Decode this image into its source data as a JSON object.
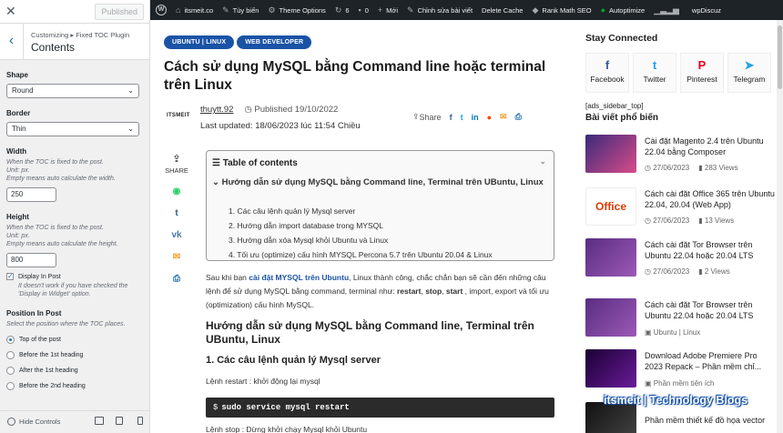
{
  "customizer": {
    "close_icon": "✕",
    "publish_label": "Published",
    "breadcrumb": "Customizing ▸ Fixed TOC Plugin",
    "section_title": "Contents",
    "shape": {
      "label": "Shape",
      "value": "Round"
    },
    "border": {
      "label": "Border",
      "value": "Thin"
    },
    "width": {
      "label": "Width",
      "desc1": "When the TOC is fixed to the post.",
      "desc2": "Unit: px.",
      "desc3": "Empty means auto calculate the width.",
      "value": "250"
    },
    "height": {
      "label": "Height",
      "desc1": "When the TOC is fixed to the post.",
      "desc2": "Unit: px.",
      "desc3": "Empty means auto calculate the height.",
      "value": "800"
    },
    "display_in_post": {
      "label": "Display In Post",
      "note1": "It doesn't work if you have checked the",
      "note2": "'Display in Widget' option.",
      "checked": true
    },
    "position": {
      "label": "Position In Post",
      "desc": "Select the position where the TOC places.",
      "options": [
        "Top of the post",
        "Before the 1st heading",
        "After the 1st heading",
        "Before the 2nd heading"
      ],
      "selected": 0
    },
    "hide_controls": "Hide Controls"
  },
  "adminbar": {
    "site": "itsmeit.co",
    "customize": "Tùy biến",
    "theme_options": "Theme Options",
    "updates": "6",
    "comments": "0",
    "new": "Mới",
    "edit": "Chỉnh sửa bài viết",
    "delete_cache": "Delete Cache",
    "rankmath": "Rank Math SEO",
    "autoptimize": "Autoptimize",
    "wpdiscuz": "wpDiscuz"
  },
  "article": {
    "categories": [
      "UBUNTU | LINUX",
      "WEB DEVELOPER"
    ],
    "title": "Cách sử dụng MySQL bằng Command line hoặc terminal trên Linux",
    "logo_text": "ITSMEIT",
    "author": "thuytt.92",
    "published": "Published 19/10/2022",
    "updated": "Last updated: 18/06/2023 lúc 11:54 Chiều",
    "share": "Share",
    "side_share": "SHARE",
    "toc": {
      "title": "Table of contents",
      "top": "Hướng dẫn sử dụng MySQL bằng Command line, Terminal trên UBuntu, Linux",
      "items": [
        "1. Các câu lệnh quản lý Mysql server",
        "2. Hướng dẫn import database trong MYSQL",
        "3. Hướng dẫn xóa Mysql khỏi Ubuntu và Linux",
        "4. Tối ưu (optimize) cấu hình MYSQL Percona 5.7 trên Ubuntu 20.04 & Linux"
      ]
    },
    "para": {
      "a": "Sau khi bạn ",
      "link": "cài đặt MYSQL trên Ubuntu",
      "b": ", Linux thành công, chắc chắn bạn sẽ cần đến những câu lệnh để sử dụng MySQL bằng command, terminal như: ",
      "c": "restart",
      "d": ", ",
      "e": "stop",
      "f": ", ",
      "g": "start",
      "h": " , import, export và tối ưu (optimization) cấu hình MySQL."
    },
    "h2": "Hướng dẫn sử dụng MySQL bằng Command line, Terminal trên UBuntu, Linux",
    "h3": "1. Các câu lệnh quản lý Mysql server",
    "p2": "Lệnh restart : khởi động lại mysql",
    "code": "sudo service mysql restart",
    "p3": "Lệnh stop : Dừng khởi chạy Mysql khỏi Ubuntu"
  },
  "sidebar": {
    "stay_connected": "Stay Connected",
    "socials": [
      "Facebook",
      "Twitter",
      "Pinterest",
      "Telegram"
    ],
    "ads": "[ads_sidebar_top]",
    "popular": "Bài viết phổ biến",
    "posts": [
      {
        "title": "Cài đặt Magento 2.4 trên Ubuntu 22.04 bằng Composer",
        "date": "27/06/2023",
        "views": "283 Views"
      },
      {
        "title": "Cách cài đặt Office 365 trên Ubuntu 22.04, 20.04 (Web App)",
        "date": "27/06/2023",
        "views": "13 Views"
      },
      {
        "title": "Cách cài đặt Tor Browser trên Ubuntu 22.04 hoặc 20.04 LTS",
        "date": "27/06/2023",
        "views": "2 Views"
      },
      {
        "title": "Cách cài đặt Tor Browser trên Ubuntu 22.04 hoặc 20.04 LTS",
        "cat": "Ubuntu | Linux"
      },
      {
        "title": "Download Adobe Premiere Pro 2023 Repack – Phần mềm chỉ...",
        "cat": "Phần mềm tiện ích"
      },
      {
        "title": "Phần mềm thiết kế đồ họa vector"
      }
    ],
    "brand": "itsmeit | Technology Blogs"
  }
}
